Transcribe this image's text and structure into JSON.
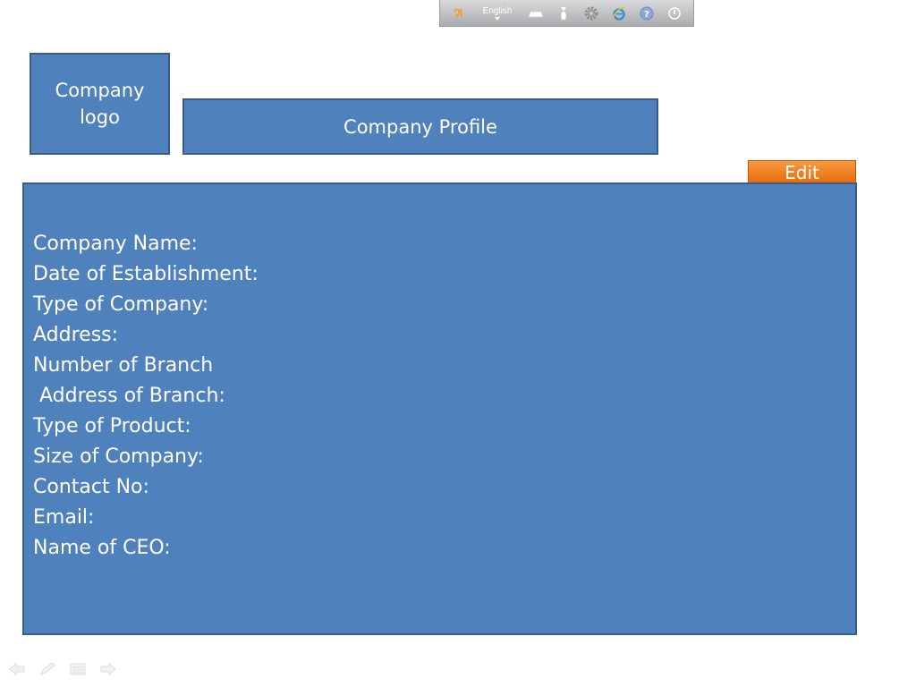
{
  "toolbar": {
    "language": "English",
    "icons": [
      "input-method-icon",
      "keyboard-icon",
      "bowling-pin-icon",
      "gear-icon",
      "ie-browser-icon",
      "help-icon",
      "power-icon"
    ]
  },
  "header": {
    "logo_placeholder": "Company logo",
    "title": "Company Profile",
    "edit_label": "Edit"
  },
  "details": {
    "fields": [
      "Company Name:",
      "Date of Establishment:",
      "Type of Company:",
      "Address:",
      "Number of Branch",
      " Address of Branch:",
      "Type of Product:",
      "Size of Company:",
      "Contact No:",
      "Email:",
      "Name of CEO:"
    ]
  },
  "colors": {
    "panel_blue": "#4f81bd",
    "panel_border": "#385d8a",
    "edit_orange": "#f79646"
  },
  "slide_nav": {
    "icons": [
      "previous-slide-icon",
      "pen-icon",
      "slide-menu-icon",
      "next-slide-icon"
    ]
  }
}
